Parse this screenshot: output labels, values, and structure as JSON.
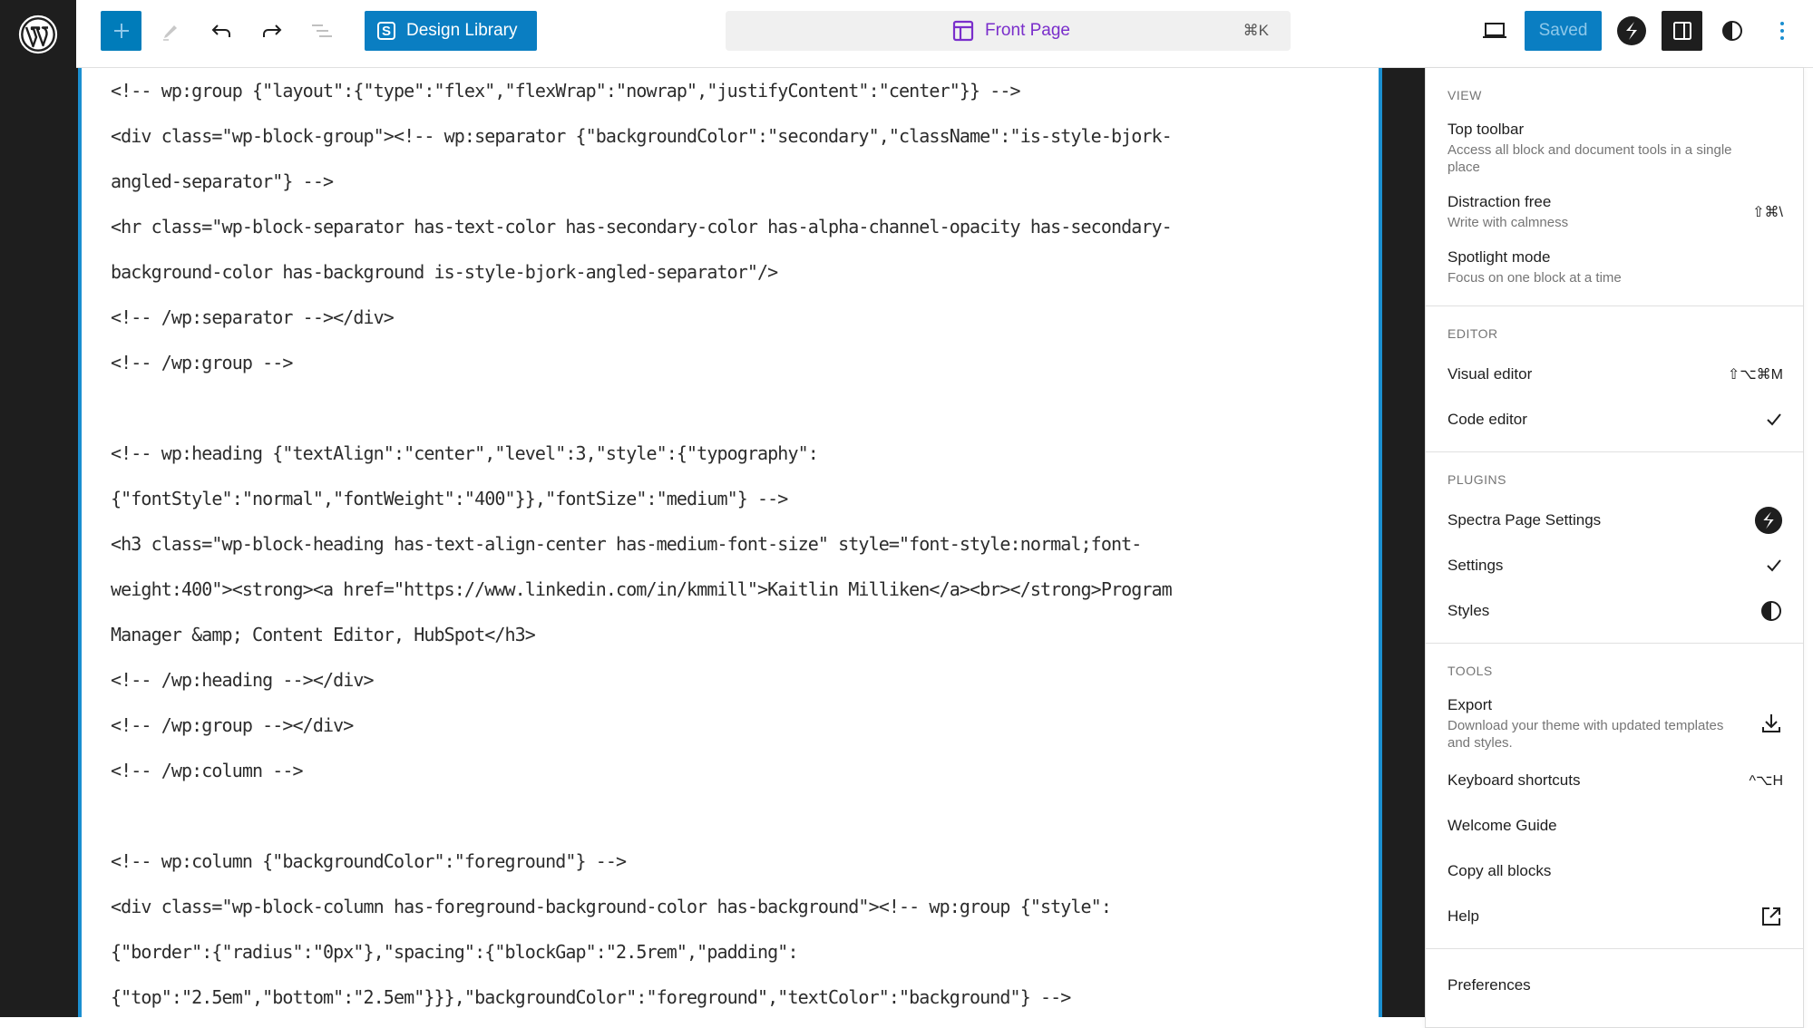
{
  "topbar": {
    "logo": "wordpress-logo",
    "inserter_icon": "plus-icon",
    "tools_icon": "pencil-icon",
    "undo_icon": "undo-icon",
    "redo_icon": "redo-icon",
    "list_view_icon": "list-view-icon",
    "design_library": {
      "icon": "S",
      "label": "Design Library"
    },
    "command_bar": {
      "title": "Front Page",
      "shortcut": "⌘K"
    },
    "view_icon": "desktop-icon",
    "save_label": "Saved",
    "spectra_icon": "spectra-icon",
    "settings_icon": "sidebar-settings-icon",
    "styles_icon": "half-circle-icon",
    "options_icon": "kebab-icon"
  },
  "colors": {
    "accent": "#007cba",
    "dark": "#1e1e1e",
    "template_purple": "#7a2ecb"
  },
  "code_lines": [
    "<!-- wp:group {\"layout\":{\"type\":\"flex\",\"flexWrap\":\"nowrap\",\"justifyContent\":\"center\"}} -->",
    "<div class=\"wp-block-group\"><!-- wp:separator {\"backgroundColor\":\"secondary\",\"className\":\"is-style-bjork-",
    "angled-separator\"} -->",
    "<hr class=\"wp-block-separator has-text-color has-secondary-color has-alpha-channel-opacity has-secondary-",
    "background-color has-background is-style-bjork-angled-separator\"/>",
    "<!-- /wp:separator --></div>",
    "<!-- /wp:group -->",
    "",
    "<!-- wp:heading {\"textAlign\":\"center\",\"level\":3,\"style\":{\"typography\":",
    "{\"fontStyle\":\"normal\",\"fontWeight\":\"400\"}},\"fontSize\":\"medium\"} -->",
    "<h3 class=\"wp-block-heading has-text-align-center has-medium-font-size\" style=\"font-style:normal;font-",
    "weight:400\"><strong><a href=\"https://www.linkedin.com/in/kmmill\">Kaitlin Milliken</a><br></strong>Program",
    "Manager &amp; Content Editor, HubSpot</h3>",
    "<!-- /wp:heading --></div>",
    "<!-- /wp:group --></div>",
    "<!-- /wp:column -->",
    "",
    "<!-- wp:column {\"backgroundColor\":\"foreground\"} -->",
    "<div class=\"wp-block-column has-foreground-background-color has-background\"><!-- wp:group {\"style\":",
    "{\"border\":{\"radius\":\"0px\"},\"spacing\":{\"blockGap\":\"2.5rem\",\"padding\":",
    "{\"top\":\"2.5em\",\"bottom\":\"2.5em\"}}},\"backgroundColor\":\"foreground\",\"textColor\":\"background\"} -->"
  ],
  "menu": {
    "view": {
      "label": "View",
      "items": [
        {
          "label": "Top toolbar",
          "desc": "Access all block and document tools in a single place",
          "right": ""
        },
        {
          "label": "Distraction free",
          "desc": "Write with calmness",
          "right": "⇧⌘\\"
        },
        {
          "label": "Spotlight mode",
          "desc": "Focus on one block at a time",
          "right": ""
        }
      ]
    },
    "editor": {
      "label": "Editor",
      "items": [
        {
          "label": "Visual editor",
          "right": "⇧⌥⌘M"
        },
        {
          "label": "Code editor",
          "right": "✓",
          "checked": true
        }
      ]
    },
    "plugins": {
      "label": "Plugins",
      "items": [
        {
          "label": "Spectra Page Settings",
          "icon": "spectra-icon"
        },
        {
          "label": "Settings",
          "right": "✓",
          "checked": true
        },
        {
          "label": "Styles",
          "icon": "half-circle-icon"
        }
      ]
    },
    "tools": {
      "label": "Tools",
      "items": [
        {
          "label": "Export",
          "desc": "Download your theme with updated templates and styles.",
          "icon": "download-icon"
        },
        {
          "label": "Keyboard shortcuts",
          "right": "^⌥H"
        },
        {
          "label": "Welcome Guide",
          "right": ""
        },
        {
          "label": "Copy all blocks",
          "right": ""
        },
        {
          "label": "Help",
          "icon": "external-link-icon"
        }
      ]
    },
    "preferences": {
      "label": "Preferences"
    }
  }
}
